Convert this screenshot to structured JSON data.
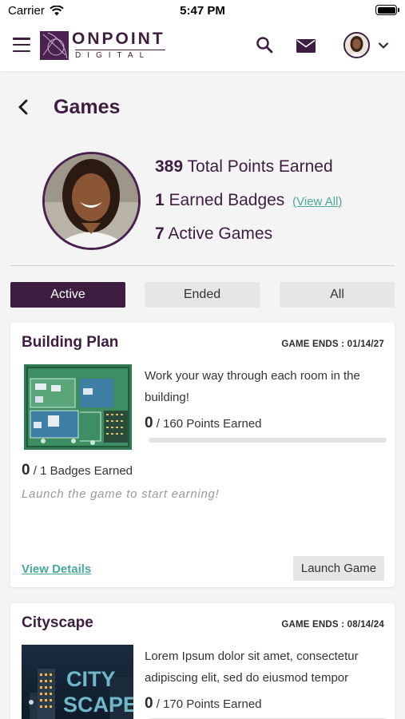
{
  "status_bar": {
    "carrier": "Carrier",
    "time": "5:47 PM"
  },
  "header": {
    "logo_top": "ONPOINT",
    "logo_bottom": "DIGITAL",
    "icons": [
      "menu-icon",
      "search-icon",
      "mail-icon",
      "chevron-down-icon"
    ],
    "brand_color": "#3d1d40",
    "accent_color": "#4aa89a"
  },
  "page": {
    "title": "Games"
  },
  "profile": {
    "total_points": "389",
    "total_points_label": "Total Points Earned",
    "badges_count": "1",
    "badges_label": "Earned Badges",
    "view_all_label": "(View All)",
    "active_games_count": "7",
    "active_games_label": "Active Games"
  },
  "filters": {
    "tabs": [
      "Active",
      "Ended",
      "All"
    ],
    "selected": "Active"
  },
  "games": [
    {
      "title": "Building Plan",
      "ends_label": "GAME ENDS : 01/14/27",
      "description": "Work your way through each room in the building!",
      "points_earned": "0",
      "points_total_label": "/ 160 Points Earned",
      "progress_fraction": 0,
      "badges_earned": "0",
      "badges_total_label": "/ 1 Badges Earned",
      "hint": "Launch the game to start earning!",
      "details_label": "View Details",
      "launch_label": "Launch Game"
    },
    {
      "title": "Cityscape",
      "ends_label": "GAME ENDS : 08/14/24",
      "description": "Lorem Ipsum dolor sit amet, consectetur adipiscing elit, sed do eiusmod tempor",
      "points_earned": "0",
      "points_total_label": "/ 170 Points Earned",
      "progress_fraction": 0,
      "thumb_text_top": "CITY",
      "thumb_text_bottom": "SCAPE"
    }
  ]
}
